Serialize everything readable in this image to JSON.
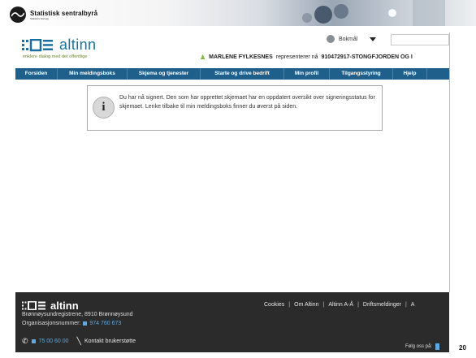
{
  "slide": {
    "org_name": "Statistisk sentralbyrå",
    "org_sub": "Statistics Norway",
    "page_number": "20"
  },
  "site": {
    "brand": "altinn",
    "tagline": "enklere dialog med det offentlige",
    "language": "Bokmål",
    "search_placeholder": "",
    "rep_user": "MARLENE FYLKESNES",
    "rep_text": "representerer nå",
    "rep_org": "910472917-STONGFJORDEN OG I"
  },
  "nav": {
    "items": [
      {
        "label": "Forsiden"
      },
      {
        "label": "Min meldingsboks"
      },
      {
        "label": "Skjema og tjenester"
      },
      {
        "label": "Starte og drive bedrift"
      },
      {
        "label": "Min profil"
      },
      {
        "label": "Tilgangsstyring"
      },
      {
        "label": "Hjelp"
      }
    ]
  },
  "notice": {
    "icon": "info-icon",
    "text": "Du har nå signert. Den som har opprettet skjemaet har en oppdatert oversikt over signeringsstatus for skjemaet. Lenke tilbake til min meldingsboks finner du øverst på siden."
  },
  "footer": {
    "brand": "altinn",
    "address": "Brønnøysundregistrene, 8910 Brønnøysund",
    "org_label": "Organisasjonsnummer:",
    "org_number": "974 760 673",
    "links": [
      "Cookies",
      "Om Altinn",
      "Altinn A-Å",
      "Driftsmeldinger",
      "A"
    ],
    "phone": "75 00 60 00",
    "support": "Kontakt brukerstøtte",
    "follow": "Følg oss på:"
  },
  "colors": {
    "nav_bg": "#1f5f8b",
    "brand_blue": "#1a6ea0",
    "footer_bg": "#2b2b2b",
    "link_blue": "#5fa8e0"
  }
}
